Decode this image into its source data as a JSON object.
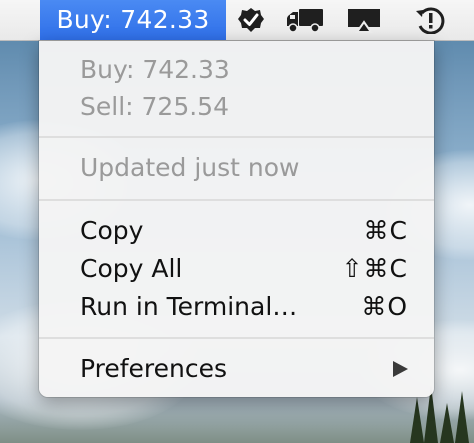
{
  "menubar": {
    "status_title": "Buy: 742.33",
    "icons": [
      "checkmark-badge-icon",
      "delivery-truck-icon",
      "airplay-icon",
      "time-machine-alert-icon"
    ]
  },
  "menu": {
    "info": {
      "buy": "Buy: 742.33",
      "sell": "Sell: 725.54"
    },
    "updated": "Updated just now",
    "items": [
      {
        "label": "Copy",
        "shortcut": "⌘C"
      },
      {
        "label": "Copy All",
        "shortcut": "⇧⌘C"
      },
      {
        "label": "Run in Terminal…",
        "shortcut": "⌘O"
      }
    ],
    "preferences": {
      "label": "Preferences",
      "submenu_icon": "chevron-right-icon"
    }
  },
  "colors": {
    "highlight": "#2f6fe8",
    "disabled_text": "#9a9a9a",
    "text": "#111111"
  }
}
